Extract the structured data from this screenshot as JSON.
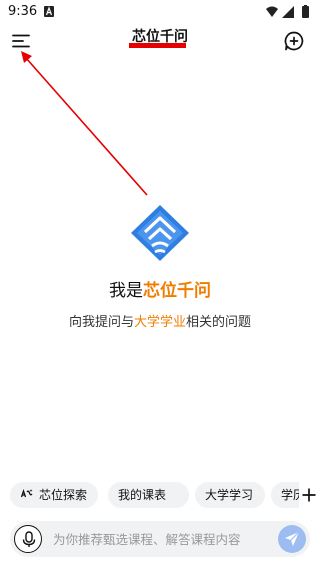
{
  "status_bar": {
    "time": "9:36"
  },
  "header": {
    "title": "芯位千问",
    "menu_icon": "hamburger-menu-icon",
    "new_chat_icon": "new-chat-plus-bubble-icon"
  },
  "hero": {
    "title_prefix": "我是",
    "title_accent": "芯位千问",
    "subtitle_prefix": "向我提问与",
    "subtitle_accent": "大学学业",
    "subtitle_suffix": "相关的问题"
  },
  "chips": [
    {
      "label": "芯位探索",
      "icon": "sparkle-ai-icon"
    },
    {
      "label": "我的课表"
    },
    {
      "label": "大学学习"
    },
    {
      "label": "学历"
    }
  ],
  "input_bar": {
    "placeholder": "为你推荐甄选课程、解答课程内容",
    "mic_icon": "microphone-icon",
    "send_icon": "send-paper-plane-icon"
  },
  "colors": {
    "accent_orange": "#f07d00",
    "annotation_red": "#e60000",
    "chip_bg": "#f1f2f4",
    "send_button": "#9dbdf2",
    "logo_blue": "#2f7fe0"
  }
}
